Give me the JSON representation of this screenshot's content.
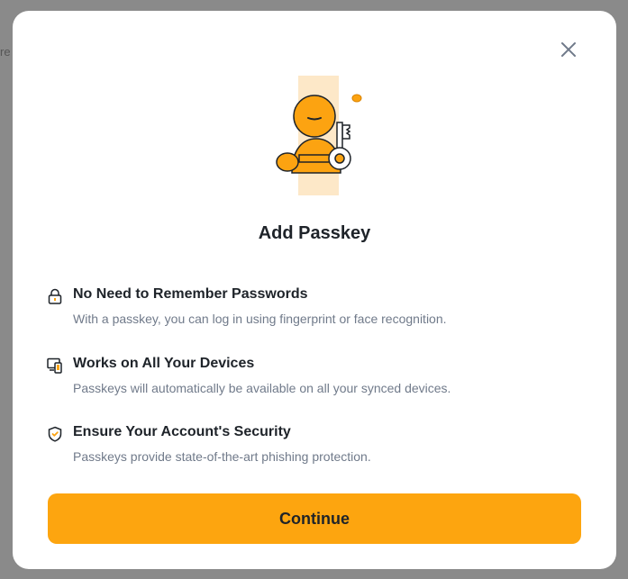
{
  "background": {
    "partial_text": "re"
  },
  "modal": {
    "title": "Add Passkey",
    "close_icon": "close-icon",
    "illustration": "passkey-illustration",
    "features": [
      {
        "icon": "lock-icon",
        "title": "No Need to Remember Passwords",
        "description": "With a passkey, you can log in using fingerprint or face recognition."
      },
      {
        "icon": "devices-icon",
        "title": "Works on All Your Devices",
        "description": "Passkeys will automatically be available on all your synced devices."
      },
      {
        "icon": "shield-icon",
        "title": "Ensure Your Account's Security",
        "description": "Passkeys provide state-of-the-art phishing protection."
      }
    ],
    "continue_label": "Continue"
  },
  "colors": {
    "accent": "#FCA311",
    "button": "#FDA50F",
    "text_primary": "#1E2329",
    "text_secondary": "#707A8A",
    "overlay": "#8A8A8A"
  }
}
